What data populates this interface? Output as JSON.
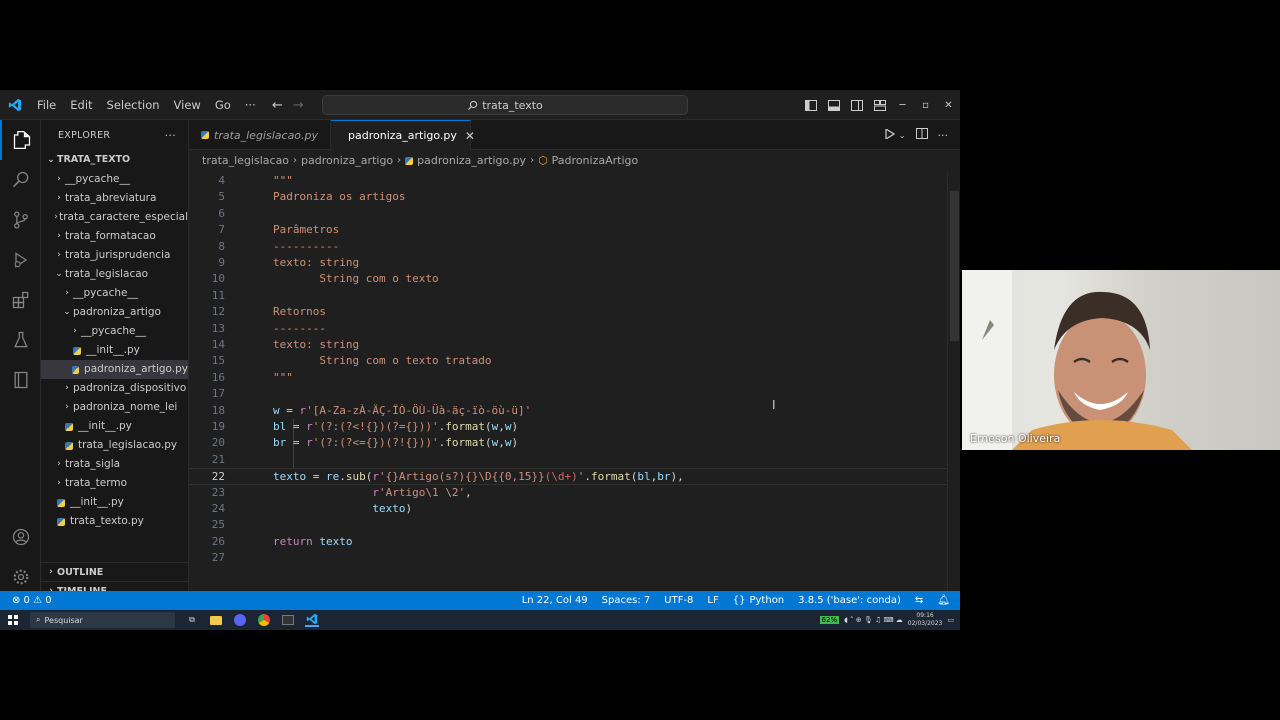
{
  "window": {
    "menu": [
      "File",
      "Edit",
      "Selection",
      "View",
      "Go",
      "···"
    ],
    "command_center": "trata_texto"
  },
  "sidebar": {
    "title": "EXPLORER",
    "more": "···",
    "root": "TRATA_TEXTO",
    "items": [
      {
        "label": "__pycache__",
        "indent": 1,
        "chev": "›",
        "py": false,
        "selected": false
      },
      {
        "label": "trata_abreviatura",
        "indent": 1,
        "chev": "›",
        "py": false,
        "selected": false
      },
      {
        "label": "trata_caractere_especial",
        "indent": 1,
        "chev": "›",
        "py": false,
        "selected": false
      },
      {
        "label": "trata_formatacao",
        "indent": 1,
        "chev": "›",
        "py": false,
        "selected": false
      },
      {
        "label": "trata_jurisprudencia",
        "indent": 1,
        "chev": "›",
        "py": false,
        "selected": false
      },
      {
        "label": "trata_legislacao",
        "indent": 1,
        "chev": "⌄",
        "py": false,
        "selected": false
      },
      {
        "label": "__pycache__",
        "indent": 2,
        "chev": "›",
        "py": false,
        "selected": false
      },
      {
        "label": "padroniza_artigo",
        "indent": 2,
        "chev": "⌄",
        "py": false,
        "selected": false
      },
      {
        "label": "__pycache__",
        "indent": 3,
        "chev": "›",
        "py": false,
        "selected": false
      },
      {
        "label": "__init__.py",
        "indent": 3,
        "chev": "",
        "py": true,
        "selected": false
      },
      {
        "label": "padroniza_artigo.py",
        "indent": 3,
        "chev": "",
        "py": true,
        "selected": true
      },
      {
        "label": "padroniza_dispositivo",
        "indent": 2,
        "chev": "›",
        "py": false,
        "selected": false
      },
      {
        "label": "padroniza_nome_lei",
        "indent": 2,
        "chev": "›",
        "py": false,
        "selected": false
      },
      {
        "label": "__init__.py",
        "indent": 2,
        "chev": "",
        "py": true,
        "selected": false
      },
      {
        "label": "trata_legislacao.py",
        "indent": 2,
        "chev": "",
        "py": true,
        "selected": false
      },
      {
        "label": "trata_sigla",
        "indent": 1,
        "chev": "›",
        "py": false,
        "selected": false
      },
      {
        "label": "trata_termo",
        "indent": 1,
        "chev": "›",
        "py": false,
        "selected": false
      },
      {
        "label": "__init__.py",
        "indent": 1,
        "chev": "",
        "py": true,
        "selected": false
      },
      {
        "label": "trata_texto.py",
        "indent": 1,
        "chev": "",
        "py": true,
        "selected": false
      }
    ],
    "outline": "OUTLINE",
    "timeline": "TIMELINE"
  },
  "tabs": [
    {
      "label": "trata_legislacao.py",
      "active": false
    },
    {
      "label": "padroniza_artigo.py",
      "active": true
    }
  ],
  "breadcrumbs": [
    "trata_legislacao",
    "padroniza_artigo",
    "padroniza_artigo.py",
    "PadronizaArtigo"
  ],
  "code": {
    "current_line": 22,
    "lines": [
      {
        "n": 4,
        "segs": [
          [
            "t-str",
            "\"\"\""
          ]
        ]
      },
      {
        "n": 5,
        "segs": [
          [
            "t-str",
            "Padroniza os artigos"
          ]
        ]
      },
      {
        "n": 6,
        "segs": []
      },
      {
        "n": 7,
        "segs": [
          [
            "t-str",
            "Parâmetros"
          ]
        ]
      },
      {
        "n": 8,
        "segs": [
          [
            "t-str",
            "----------"
          ]
        ]
      },
      {
        "n": 9,
        "segs": [
          [
            "t-str",
            "texto: string"
          ]
        ]
      },
      {
        "n": 10,
        "segs": [
          [
            "t-str",
            "       String com o texto"
          ]
        ]
      },
      {
        "n": 11,
        "segs": []
      },
      {
        "n": 12,
        "segs": [
          [
            "t-str",
            "Retornos"
          ]
        ]
      },
      {
        "n": 13,
        "segs": [
          [
            "t-str",
            "--------"
          ]
        ]
      },
      {
        "n": 14,
        "segs": [
          [
            "t-str",
            "texto: string"
          ]
        ]
      },
      {
        "n": 15,
        "segs": [
          [
            "t-str",
            "       String com o texto tratado"
          ]
        ]
      },
      {
        "n": 16,
        "segs": [
          [
            "t-str",
            "\"\"\""
          ]
        ]
      },
      {
        "n": 17,
        "segs": []
      },
      {
        "n": 18,
        "segs": [
          [
            "t-var",
            "w"
          ],
          [
            "t-op",
            " = "
          ],
          [
            "t-kw",
            "r"
          ],
          [
            "t-str",
            "'[A-Za-zÀ-ÄÇ-ÏÒ-ÖÙ-Üà-äç-ïò-öù-ü]'"
          ]
        ]
      },
      {
        "n": 19,
        "segs": [
          [
            "t-var",
            "bl"
          ],
          [
            "t-op",
            " = "
          ],
          [
            "t-kw",
            "r"
          ],
          [
            "t-str",
            "'(?:(?<!{})(?={}))'"
          ],
          [
            "t-op",
            "."
          ],
          [
            "t-fn",
            "format"
          ],
          [
            "t-op",
            "("
          ],
          [
            "t-var",
            "w"
          ],
          [
            "t-op",
            ","
          ],
          [
            "t-var",
            "w"
          ],
          [
            "t-op",
            ")"
          ]
        ]
      },
      {
        "n": 20,
        "segs": [
          [
            "t-var",
            "br"
          ],
          [
            "t-op",
            " = "
          ],
          [
            "t-kw",
            "r"
          ],
          [
            "t-str",
            "'(?:(?<={})(?!{}))'"
          ],
          [
            "t-op",
            "."
          ],
          [
            "t-fn",
            "format"
          ],
          [
            "t-op",
            "("
          ],
          [
            "t-var",
            "w"
          ],
          [
            "t-op",
            ","
          ],
          [
            "t-var",
            "w"
          ],
          [
            "t-op",
            ")"
          ]
        ]
      },
      {
        "n": 21,
        "segs": []
      },
      {
        "n": 22,
        "segs": [
          [
            "t-var",
            "texto"
          ],
          [
            "t-op",
            " = "
          ],
          [
            "t-var",
            "re"
          ],
          [
            "t-op",
            "."
          ],
          [
            "t-fn",
            "sub"
          ],
          [
            "t-op",
            "("
          ],
          [
            "t-kw",
            "r"
          ],
          [
            "t-str",
            "'{}Artigo(s?){}\\D{{0,15}}"
          ],
          [
            "t-re",
            "(\\d+)"
          ],
          [
            "t-str",
            "'"
          ],
          [
            "t-op",
            "."
          ],
          [
            "t-fn",
            "format"
          ],
          [
            "t-op",
            "("
          ],
          [
            "t-var",
            "bl"
          ],
          [
            "t-op",
            ","
          ],
          [
            "t-var",
            "br"
          ],
          [
            "t-op",
            "),"
          ]
        ]
      },
      {
        "n": 23,
        "segs": [
          [
            "t-op",
            "               "
          ],
          [
            "t-kw",
            "r"
          ],
          [
            "t-str",
            "'Artigo\\1 \\2'"
          ],
          [
            "t-op",
            ","
          ]
        ]
      },
      {
        "n": 24,
        "segs": [
          [
            "t-op",
            "               "
          ],
          [
            "t-var",
            "texto"
          ],
          [
            "t-op",
            ")"
          ]
        ]
      },
      {
        "n": 25,
        "segs": []
      },
      {
        "n": 26,
        "segs": [
          [
            "t-kw",
            "return"
          ],
          [
            "t-op",
            " "
          ],
          [
            "t-var",
            "texto"
          ]
        ]
      },
      {
        "n": 27,
        "segs": []
      }
    ]
  },
  "statusbar": {
    "problems": "⊗ 0 ⚠ 0",
    "position": "Ln 22, Col 49",
    "spaces": "Spaces: 7",
    "encoding": "UTF-8",
    "eol": "LF",
    "language": "Python",
    "interpreter": "3.8.5 ('base': conda)"
  },
  "taskbar": {
    "search_placeholder": "Pesquisar",
    "battery": "62%",
    "time": "09:16",
    "date": "02/03/2023"
  },
  "webcam": {
    "name": "Erneson Oliveira"
  },
  "colors": {
    "accent": "#0078d4",
    "editor_bg": "#1f1f1f",
    "sidebar_bg": "#181818",
    "string": "#ce9178",
    "variable": "#9cdcfe",
    "function": "#dcdcaa",
    "keyword": "#c586c0"
  }
}
